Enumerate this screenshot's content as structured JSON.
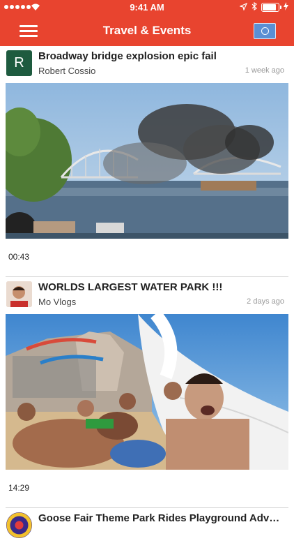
{
  "status_bar": {
    "time": "9:41 AM",
    "battery_level": 0.95
  },
  "navbar": {
    "title": "Travel & Events",
    "accent": "#e8442f"
  },
  "posts": [
    {
      "avatar_letter": "R",
      "avatar_color": "#1e5b3f",
      "title": "Broadway bridge explosion epic fail",
      "channel": "Robert Cossio",
      "time": "1 week ago",
      "duration": "00:43"
    },
    {
      "avatar_letter": "",
      "avatar_color": "#e0b8a4",
      "title": "WORLDS LARGEST WATER PARK !!!",
      "channel": "Mo Vlogs",
      "time": "2 days ago",
      "duration": "14:29"
    },
    {
      "avatar_letter": "",
      "avatar_color": "#3a2a8a",
      "title": "Goose Fair Theme Park Rides Playground Adventure"
    }
  ]
}
